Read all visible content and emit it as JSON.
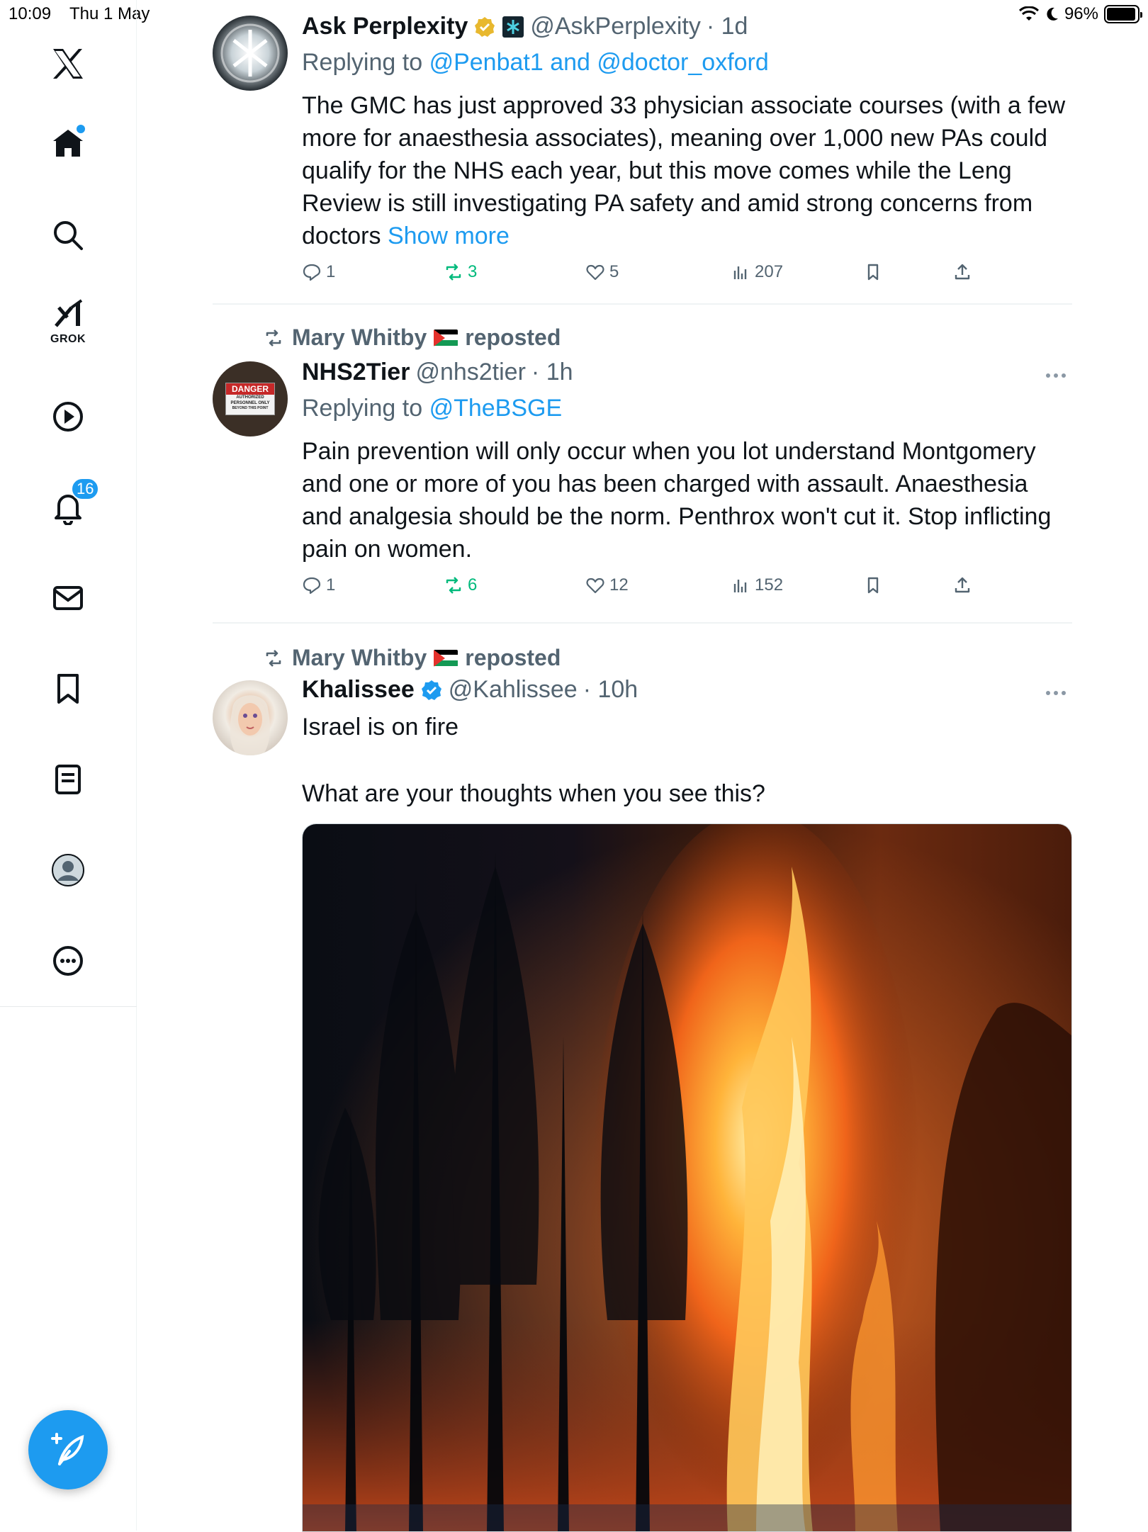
{
  "status_bar": {
    "time": "10:09",
    "date": "Thu 1 May",
    "battery": "96%",
    "battery_level": 0.96
  },
  "sidebar": {
    "items": [
      {
        "label": "Home",
        "icon": "home-icon"
      },
      {
        "label": "Search",
        "icon": "search-icon"
      },
      {
        "label": "GROK",
        "icon": "grok-icon"
      },
      {
        "label": "Video",
        "icon": "play-icon"
      },
      {
        "label": "Notifications",
        "icon": "bell-icon",
        "badge": "16"
      },
      {
        "label": "Messages",
        "icon": "mail-icon"
      },
      {
        "label": "Bookmarks",
        "icon": "bookmark-icon"
      },
      {
        "label": "Lists",
        "icon": "list-icon"
      },
      {
        "label": "Profile",
        "icon": "profile-icon"
      },
      {
        "label": "More",
        "icon": "more-icon"
      }
    ],
    "grok_label": "GROK",
    "notif_badge": "16"
  },
  "tweets": [
    {
      "name": "Ask Perplexity",
      "handle": "@AskPerplexity",
      "time": "· 1d",
      "reply_prefix": "Replying to",
      "reply_mentions": "@Penbat1 and @doctor_oxford",
      "text": "The GMC has just approved 33 physician associate courses (with a few more for anaesthesia associates), meaning over 1,000 new PAs could qualify for the NHS each year, but this move comes while the Leng Review is still investigating PA safety and amid strong concerns from doctors",
      "show_more": "Show more",
      "replies": "1",
      "reposts": "3",
      "likes": "5",
      "views": "207"
    },
    {
      "reposted_by": "Mary Whitby",
      "reposted_label": "reposted",
      "name": "NHS2Tier",
      "handle": "@nhs2tier",
      "time": "· 1h",
      "reply_prefix": "Replying to",
      "reply_mentions": "@TheBSGE",
      "text": "Pain prevention will only occur when you lot understand Montgomery and one or more of you has been charged with assault. Anaesthesia and analgesia should be the norm. Penthrox won't cut it. Stop inflicting pain on women.",
      "replies": "1",
      "reposts": "6",
      "likes": "12",
      "views": "152",
      "avatar_sign": {
        "title": "DANGER",
        "sub1": "AUTHORIZED",
        "sub2": "PERSONNEL ONLY",
        "sub3": "BEYOND THIS POINT"
      }
    },
    {
      "reposted_by": "Mary Whitby",
      "reposted_label": "reposted",
      "name": "Khalissee",
      "handle": "@Kahlissee",
      "time": "· 10h",
      "text_line1": "Israel is on fire",
      "text_line2": "What are your thoughts when you see this?"
    }
  ],
  "colors": {
    "accent": "#1d9bf0",
    "repost_green": "#00ba7c",
    "muted": "#536471"
  }
}
